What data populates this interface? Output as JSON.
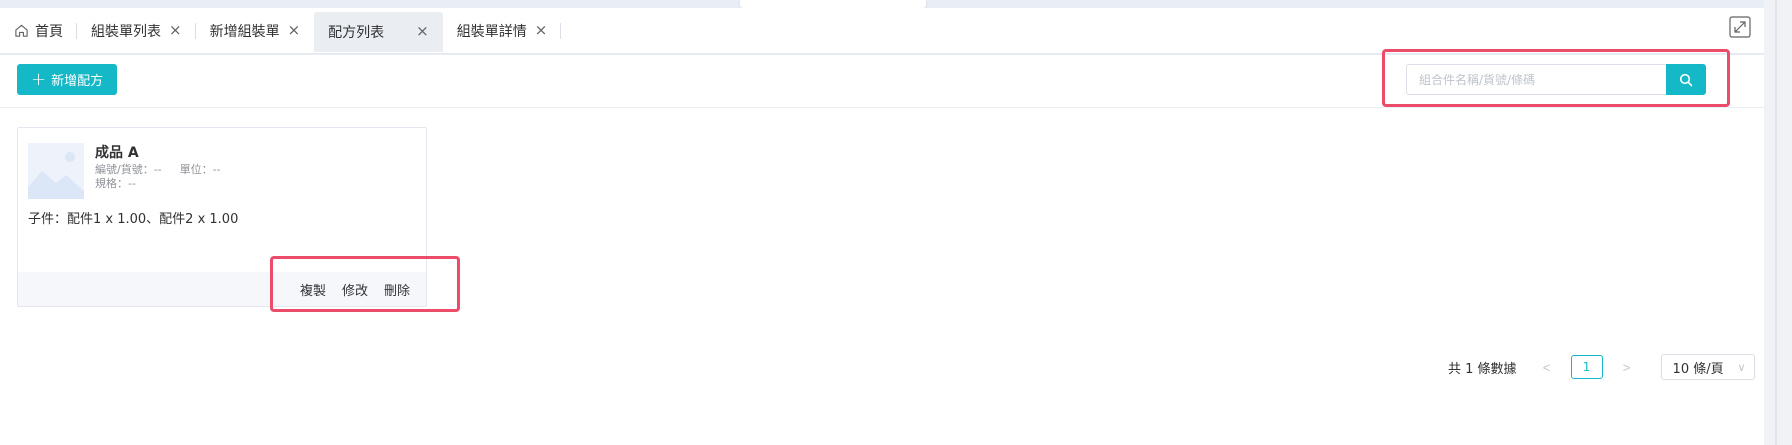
{
  "tabs": [
    {
      "label": "首頁",
      "icon": "home-icon",
      "closable": false,
      "active": false
    },
    {
      "label": "組裝單列表",
      "closable": true,
      "active": false
    },
    {
      "label": "新增組裝單",
      "closable": true,
      "active": false
    },
    {
      "label": "配方列表",
      "closable": true,
      "active": true
    },
    {
      "label": "組裝單詳情",
      "closable": true,
      "active": false
    }
  ],
  "tab_close_glyph": "×",
  "toolbar": {
    "add_label": "新增配方",
    "add_plus": "+",
    "search_placeholder": "組合件名稱/貨號/條碼",
    "search_value": ""
  },
  "card": {
    "title": "成品 A",
    "code_label": "編號/貨號：--",
    "unit_label": "單位：--",
    "spec_label": "規格：--",
    "children": "子件：配件1 x 1.00、配件2 x 1.00",
    "actions": {
      "copy": "複製",
      "edit": "修改",
      "delete": "刪除"
    }
  },
  "pagination": {
    "total_text": "共 1 條數據",
    "prev": "<",
    "current_page": "1",
    "next": ">",
    "page_size": "10 條/頁",
    "page_size_chevron": "∨"
  },
  "colors": {
    "accent": "#14b8c7",
    "highlight_box": "#ea4c6a"
  }
}
